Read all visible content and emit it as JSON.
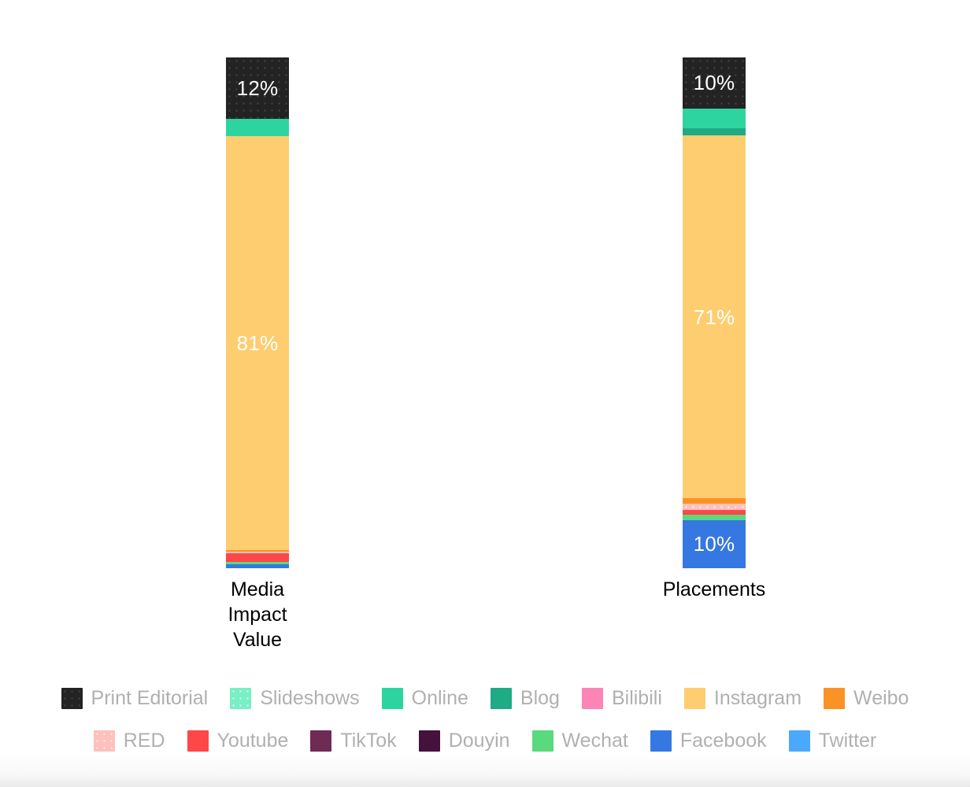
{
  "chart_data": {
    "type": "bar",
    "subtype": "stacked-100-percent-vertical",
    "title": "",
    "subtitle": "",
    "xlabel": "",
    "ylabel": "",
    "ylim": [
      0,
      100
    ],
    "grid": false,
    "legend_position": "bottom",
    "categories": [
      "Media\nImpact\nValue",
      "Placements"
    ],
    "category_labels": [
      {
        "lines": [
          "Media",
          "Impact",
          "Value"
        ]
      },
      {
        "lines": [
          "Placements"
        ]
      }
    ],
    "series": [
      {
        "name": "Print Editorial",
        "color": "#232323",
        "pattern": "dots",
        "values": [
          12.0,
          10.0
        ],
        "labels": [
          "12%",
          "10%"
        ]
      },
      {
        "name": "Slideshows",
        "color": "#78efc4",
        "pattern": "dots",
        "values": [
          0.0,
          0.0
        ],
        "labels": [
          "",
          ""
        ]
      },
      {
        "name": "Online",
        "color": "#2ed4a0",
        "pattern": "solid",
        "values": [
          3.4,
          3.9
        ],
        "labels": [
          "",
          ""
        ]
      },
      {
        "name": "Blog",
        "color": "#1fab84",
        "pattern": "solid",
        "values": [
          0.0,
          1.4
        ],
        "labels": [
          "",
          ""
        ]
      },
      {
        "name": "Bilibili",
        "color": "#fd85b6",
        "pattern": "solid",
        "values": [
          0.0,
          0.0
        ],
        "labels": [
          "",
          ""
        ]
      },
      {
        "name": "Instagram",
        "color": "#fecd70",
        "pattern": "solid",
        "values": [
          81.0,
          71.0
        ],
        "labels": [
          "81%",
          "71%"
        ]
      },
      {
        "name": "Weibo",
        "color": "#fb9226",
        "pattern": "solid",
        "values": [
          0.3,
          1.1
        ],
        "labels": [
          "",
          ""
        ]
      },
      {
        "name": "RED",
        "color": "#fdc0bd",
        "pattern": "dots",
        "values": [
          0.3,
          1.2
        ],
        "labels": [
          "",
          ""
        ]
      },
      {
        "name": "Youtube",
        "color": "#fd4749",
        "pattern": "solid",
        "values": [
          1.7,
          0.9
        ],
        "labels": [
          "",
          ""
        ]
      },
      {
        "name": "TikTok",
        "color": "#6e2b54",
        "pattern": "solid",
        "values": [
          0.0,
          0.0
        ],
        "labels": [
          "",
          ""
        ]
      },
      {
        "name": "Douyin",
        "color": "#45123c",
        "pattern": "solid",
        "values": [
          0.0,
          0.0
        ],
        "labels": [
          "",
          ""
        ]
      },
      {
        "name": "Wechat",
        "color": "#5bd97e",
        "pattern": "solid",
        "values": [
          0.6,
          1.1
        ],
        "labels": [
          "",
          ""
        ]
      },
      {
        "name": "Facebook",
        "color": "#3578e1",
        "pattern": "solid",
        "values": [
          0.7,
          9.4
        ],
        "labels": [
          "",
          "10%"
        ]
      },
      {
        "name": "Twitter",
        "color": "#4aa9fb",
        "pattern": "solid",
        "values": [
          0.0,
          0.0
        ],
        "labels": [
          "",
          ""
        ]
      }
    ],
    "value_labels": [
      {
        "category": "Media Impact Value",
        "series": "Print Editorial",
        "text": "12%"
      },
      {
        "category": "Media Impact Value",
        "series": "Instagram",
        "text": "81%"
      },
      {
        "category": "Placements",
        "series": "Print Editorial",
        "text": "10%"
      },
      {
        "category": "Placements",
        "series": "Instagram",
        "text": "71%"
      },
      {
        "category": "Placements",
        "series": "Facebook",
        "text": "10%"
      }
    ]
  },
  "legend": {
    "rows": [
      [
        {
          "label": "Print Editorial",
          "color": "#232323",
          "pattern": "dots"
        },
        {
          "label": "Slideshows",
          "color": "#78efc4",
          "pattern": "dots"
        },
        {
          "label": "Online",
          "color": "#2ed4a0",
          "pattern": "solid"
        },
        {
          "label": "Blog",
          "color": "#1fab84",
          "pattern": "solid"
        },
        {
          "label": "Bilibili",
          "color": "#fd85b6",
          "pattern": "solid"
        },
        {
          "label": "Instagram",
          "color": "#fecd70",
          "pattern": "solid"
        },
        {
          "label": "Weibo",
          "color": "#fb9226",
          "pattern": "solid"
        }
      ],
      [
        {
          "label": "RED",
          "color": "#fdc0bd",
          "pattern": "dots"
        },
        {
          "label": "Youtube",
          "color": "#fd4749",
          "pattern": "solid"
        },
        {
          "label": "TikTok",
          "color": "#6e2b54",
          "pattern": "solid"
        },
        {
          "label": "Douyin",
          "color": "#45123c",
          "pattern": "solid"
        },
        {
          "label": "Wechat",
          "color": "#5bd97e",
          "pattern": "solid"
        },
        {
          "label": "Facebook",
          "color": "#3578e1",
          "pattern": "solid"
        },
        {
          "label": "Twitter",
          "color": "#4aa9fb",
          "pattern": "solid"
        }
      ]
    ],
    "text_color": "#b0b0b0"
  },
  "theme": {
    "background": "#ffffff",
    "label_text_color": "#000000",
    "value_label_color": "#ffffff"
  }
}
